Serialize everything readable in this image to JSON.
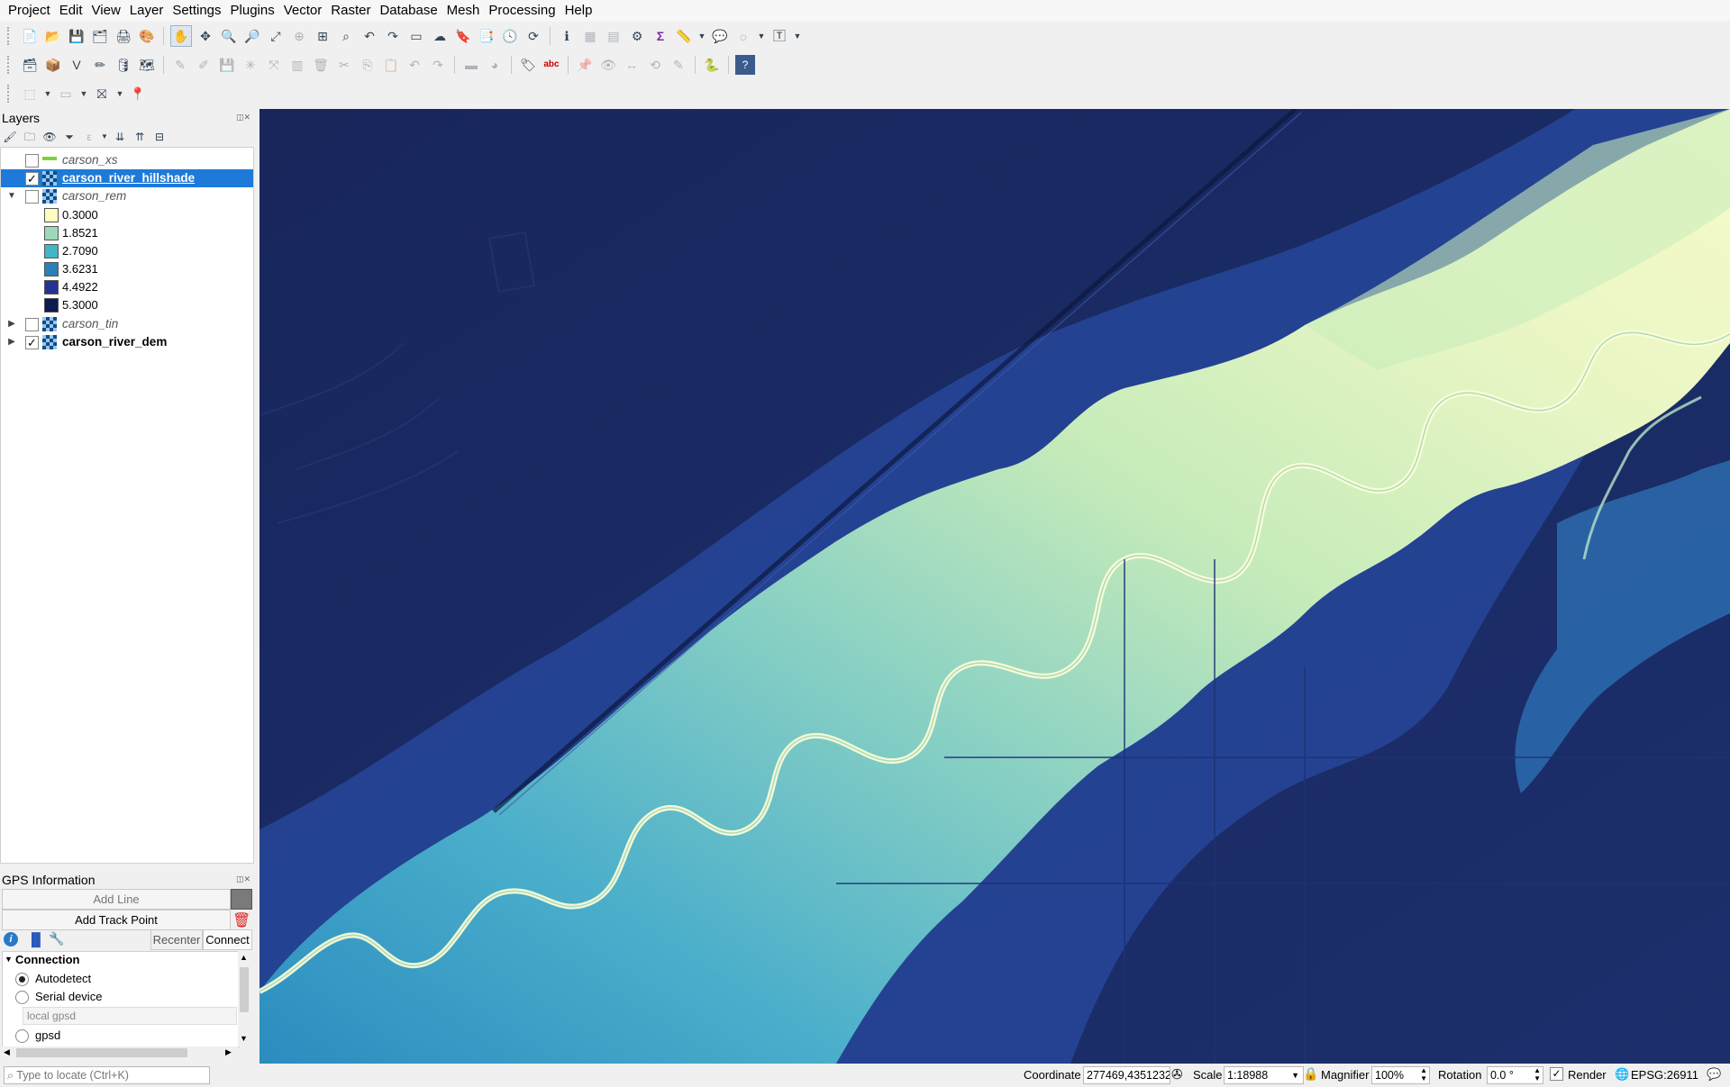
{
  "menu": [
    "Project",
    "Edit",
    "View",
    "Layer",
    "Settings",
    "Plugins",
    "Vector",
    "Raster",
    "Database",
    "Mesh",
    "Processing",
    "Help"
  ],
  "layers_panel": {
    "title": "Layers",
    "layers": [
      {
        "name": "carson_xs",
        "checked": false,
        "style": "italic",
        "type": "line"
      },
      {
        "name": "carson_river_hillshade",
        "checked": true,
        "style": "bold-selected",
        "type": "raster"
      },
      {
        "name": "carson_rem",
        "checked": false,
        "style": "italic",
        "type": "raster",
        "expanded": true
      },
      {
        "name": "carson_tin",
        "checked": false,
        "style": "italic",
        "type": "raster"
      },
      {
        "name": "carson_river_dem",
        "checked": true,
        "style": "bold",
        "type": "raster"
      }
    ],
    "legend": [
      {
        "label": "0.3000",
        "color": "#fdfdbf"
      },
      {
        "label": "1.8521",
        "color": "#9ed8b8"
      },
      {
        "label": "2.7090",
        "color": "#41b6c4"
      },
      {
        "label": "3.6231",
        "color": "#2c7fb8"
      },
      {
        "label": "4.4922",
        "color": "#253494"
      },
      {
        "label": "5.3000",
        "color": "#0e1b4d"
      }
    ]
  },
  "gps_panel": {
    "title": "GPS Information",
    "add_line": "Add Line",
    "add_track_point": "Add Track Point",
    "recenter": "Recenter",
    "connect": "Connect",
    "connection_section": "Connection",
    "options": [
      {
        "label": "Autodetect",
        "selected": true
      },
      {
        "label": "Serial device",
        "selected": false
      },
      {
        "label": "gpsd",
        "selected": false
      }
    ],
    "gpsd_field_placeholder": "local gpsd"
  },
  "locator": {
    "placeholder": "Type to locate (Ctrl+K)"
  },
  "status_bar": {
    "coordinate_label": "Coordinate",
    "coordinate_value": "277469,4351232",
    "scale_label": "Scale",
    "scale_value": "1:18988",
    "magnifier_label": "Magnifier",
    "magnifier_value": "100%",
    "rotation_label": "Rotation",
    "rotation_value": "0.0 °",
    "render_label": "Render",
    "render_checked": true,
    "crs": "EPSG:26911"
  },
  "colors": {
    "selection": "#1e7ad8",
    "map_low": "#18275e",
    "map_high": "#f6fbc8"
  }
}
